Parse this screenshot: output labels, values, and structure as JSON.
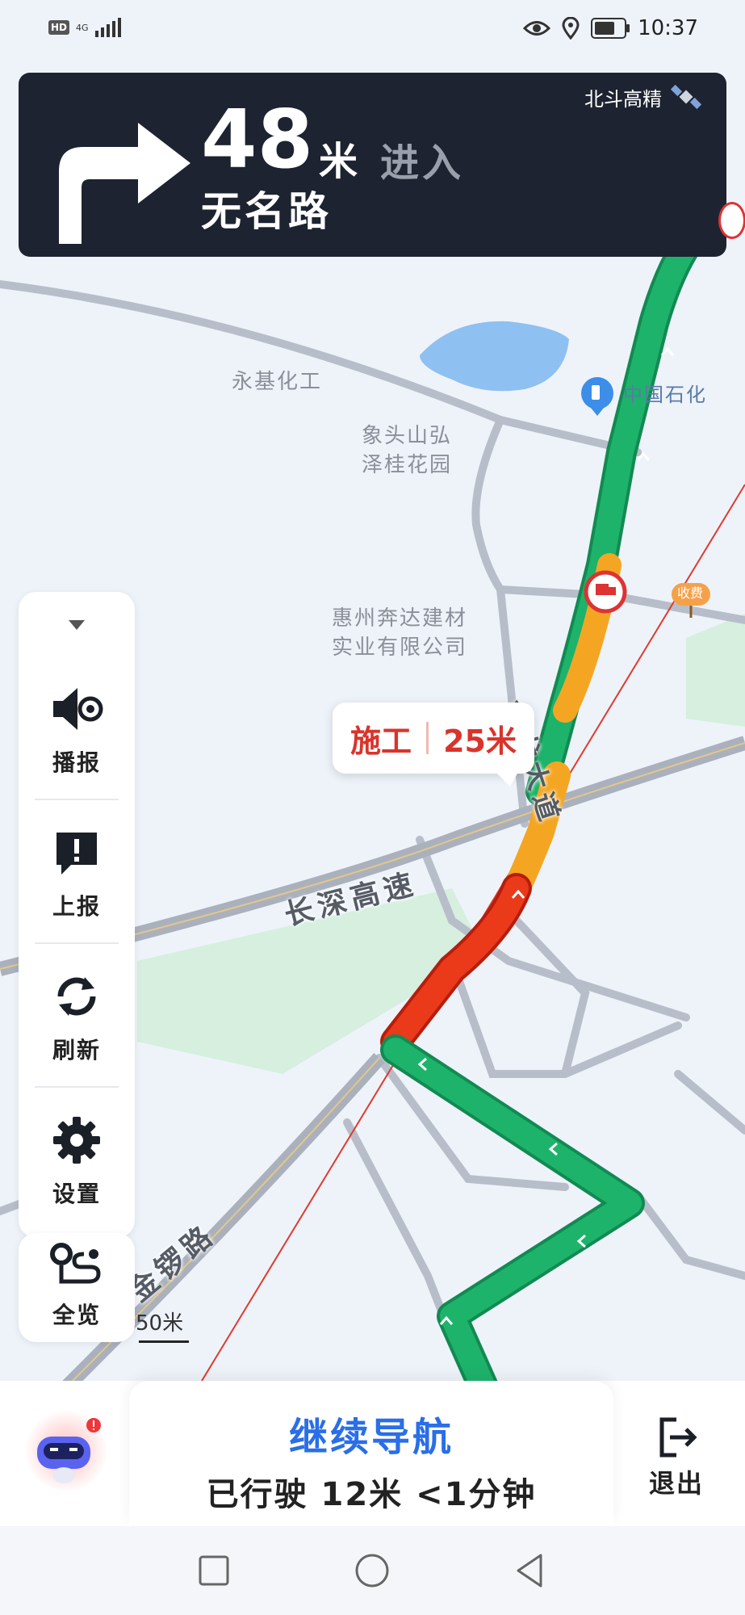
{
  "status_bar": {
    "hd": "HD",
    "network": "4G",
    "time": "10:37",
    "battery_level": 0.75
  },
  "navigation": {
    "turn_direction": "turn-right",
    "distance": "48",
    "distance_unit": "米",
    "action": "进入",
    "road_name": "无名路",
    "positioning": "北斗高精"
  },
  "map_labels": {
    "poi_1": "永基化工",
    "poi_2": "象头山弘\n泽桂花园",
    "poi_3": "惠州奔达建材\n实业有限公司",
    "poi_4": "中国石化",
    "toll": "收费"
  },
  "road_labels": {
    "road_1": "金龙大道",
    "road_2": "长深高速",
    "road_3": "金锣路"
  },
  "incident": {
    "type": "施工",
    "distance": "25米"
  },
  "toolbar": {
    "items": [
      {
        "label": "播报",
        "icon": "speaker-icon"
      },
      {
        "label": "上报",
        "icon": "report-icon"
      },
      {
        "label": "刷新",
        "icon": "refresh-icon"
      },
      {
        "label": "设置",
        "icon": "settings-icon"
      }
    ],
    "overview_label": "全览"
  },
  "scale": "50米",
  "bottom": {
    "continue_label": "继续导航",
    "trip_info": "已行驶 12米 <1分钟",
    "exit_label": "退出"
  },
  "colors": {
    "route_green": "#1db36b",
    "route_red": "#ea3a1a",
    "route_yellow": "#f4a623",
    "accent_blue": "#2a6ee8",
    "panel_dark": "#1d2330"
  }
}
